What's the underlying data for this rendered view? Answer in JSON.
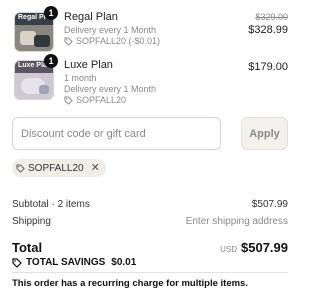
{
  "items": [
    {
      "thumb_label": "Regal Pl",
      "quantity": "1",
      "name": "Regal Plan",
      "lines": [],
      "frequency": "Delivery every 1 Month",
      "discount": "SOPFALL20 (-$0.01)",
      "original_price": "$329.00",
      "price": "$328.99"
    },
    {
      "thumb_label": "Luxe Pla",
      "quantity": "1",
      "name": "Luxe Plan",
      "duration": "1 month",
      "frequency": "Delivery every 1 Month",
      "discount": "SOPFALL20",
      "price": "$179.00"
    }
  ],
  "discount_field": {
    "placeholder": "Discount code or gift card",
    "value": ""
  },
  "apply_label": "Apply",
  "applied_code": {
    "code": "SOPFALL20",
    "remove_icon": "close-icon"
  },
  "summary": {
    "subtotal_label": "Subtotal · 2 items",
    "subtotal_value": "$507.99",
    "shipping_label": "Shipping",
    "shipping_value": "Enter shipping address"
  },
  "total": {
    "label": "Total",
    "currency": "USD",
    "amount": "$507.99"
  },
  "savings": {
    "label": "TOTAL SAVINGS",
    "amount": "$0.01"
  },
  "notice": "This order has a recurring charge for multiple items."
}
